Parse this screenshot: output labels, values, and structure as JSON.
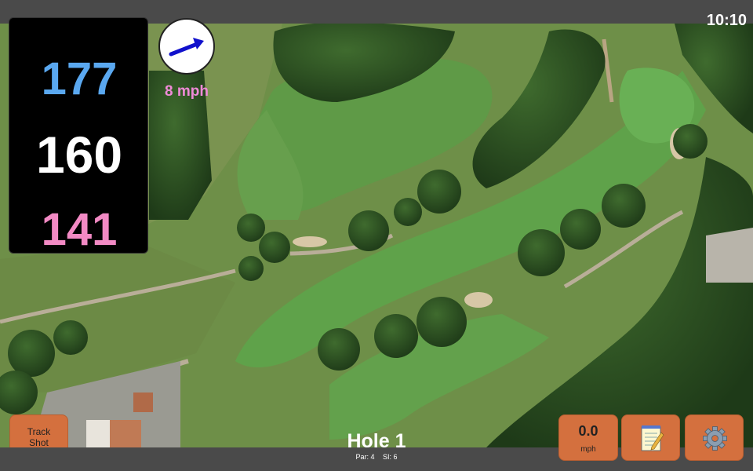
{
  "status": {
    "clock": "10:10"
  },
  "distances": {
    "back": "177",
    "middle": "160",
    "front": "141"
  },
  "wind": {
    "speed_label": "8 mph",
    "icon": "wind-direction-arrow-icon"
  },
  "hole": {
    "title": "Hole 1",
    "par_label": "Par: 4",
    "si_label": "SI: 6"
  },
  "buttons": {
    "track_line1": "Track",
    "track_line2": "Shot",
    "speed_value": "0.0",
    "speed_unit": "mph",
    "notes_icon": "notepad-icon",
    "settings_icon": "gear-icon"
  },
  "colors": {
    "back_distance": "#5aa8f0",
    "middle_distance": "#ffffff",
    "front_distance": "#f28ac4",
    "button": "#d4703e",
    "wind_text": "#f08ad8"
  }
}
